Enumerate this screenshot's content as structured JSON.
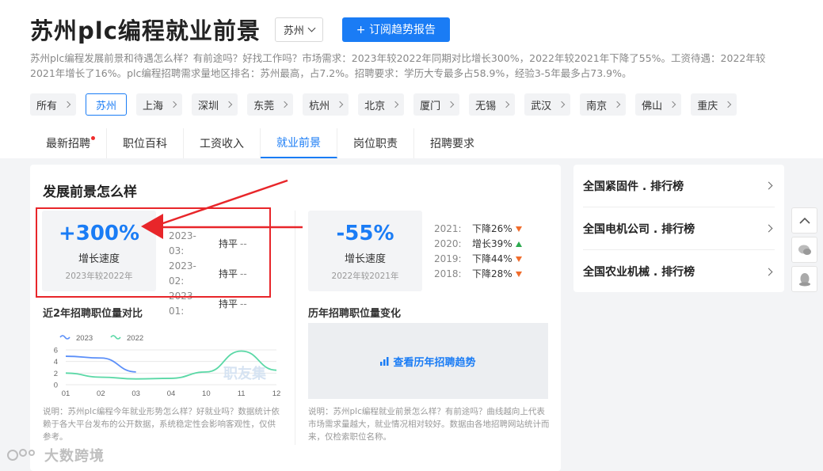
{
  "header": {
    "title": "苏州plc编程就业前景",
    "city_select": "苏州",
    "subscribe_button": "+ 订阅趋势报告",
    "description": "苏州plc编程发展前景和待遇怎么样？有前途吗？好找工作吗？市场需求：2023年较2022年同期对比增长300%，2022年较2021年下降了55%。工资待遇：2022年较2021年增长了16%。plc编程招聘需求量地区排名：苏州最高，占7.2%。招聘要求：学历大专最多占58.9%，经验3-5年最多占73.9%。"
  },
  "cities": [
    {
      "label": "所有",
      "active": false
    },
    {
      "label": "苏州",
      "active": true
    },
    {
      "label": "上海",
      "active": false
    },
    {
      "label": "深圳",
      "active": false
    },
    {
      "label": "东莞",
      "active": false
    },
    {
      "label": "杭州",
      "active": false
    },
    {
      "label": "北京",
      "active": false
    },
    {
      "label": "厦门",
      "active": false
    },
    {
      "label": "无锡",
      "active": false
    },
    {
      "label": "武汉",
      "active": false
    },
    {
      "label": "南京",
      "active": false
    },
    {
      "label": "佛山",
      "active": false
    },
    {
      "label": "重庆",
      "active": false
    }
  ],
  "tabs": [
    {
      "label": "最新招聘",
      "active": false,
      "dot": true
    },
    {
      "label": "职位百科",
      "active": false,
      "dot": false
    },
    {
      "label": "工资收入",
      "active": false,
      "dot": false
    },
    {
      "label": "就业前景",
      "active": true,
      "dot": false
    },
    {
      "label": "岗位职责",
      "active": false,
      "dot": false
    },
    {
      "label": "招聘要求",
      "active": false,
      "dot": false
    }
  ],
  "main": {
    "section_title": "发展前景怎么样",
    "stat1": {
      "value": "+300%",
      "label": "增长速度",
      "sub": "2023年较2022年"
    },
    "list1": [
      {
        "k": "2023-03:",
        "v": "持平",
        "t": "--"
      },
      {
        "k": "2023-02:",
        "v": "持平",
        "t": "--"
      },
      {
        "k": "2023-01:",
        "v": "持平",
        "t": "--"
      }
    ],
    "stat2": {
      "value": "-55%",
      "label": "增长速度",
      "sub": "2022年较2021年"
    },
    "list2": [
      {
        "k": "2021:",
        "v": "下降26%",
        "dir": "down"
      },
      {
        "k": "2020:",
        "v": "增长39%",
        "dir": "up"
      },
      {
        "k": "2019:",
        "v": "下降44%",
        "dir": "down"
      },
      {
        "k": "2018:",
        "v": "下降28%",
        "dir": "down"
      }
    ],
    "chart_title": "近2年招聘职位量对比",
    "trend_title": "历年招聘职位量变化",
    "trend_link": "查看历年招聘趋势",
    "note_left": "说明：苏州plc编程今年就业形势怎么样？好就业吗？数据统计依赖于各大平台发布的公开数据，系统稳定性会影响客观性，仅供参考。",
    "note_right": "说明：苏州plc编程就业前景怎么样？有前途吗？曲线越向上代表市场需求量越大，就业情况相对较好。数据由各地招聘网站统计而来，仅检索职位名称。",
    "chart_watermark": "职友集"
  },
  "side": {
    "ranks": [
      {
        "label": "全国紧固件 . 排行榜"
      },
      {
        "label": "全国电机公司 . 排行榜"
      },
      {
        "label": "全国农业机械 . 排行榜"
      }
    ]
  },
  "watermark": "大数跨境",
  "chart_data": {
    "type": "line",
    "title": "近2年招聘职位量对比",
    "categories": [
      "01",
      "02",
      "03",
      "04",
      "10",
      "11",
      "12"
    ],
    "series": [
      {
        "name": "2023",
        "values": [
          4.9,
          4.6,
          2.2,
          null,
          null,
          null,
          null
        ],
        "color": "#5b8ff9"
      },
      {
        "name": "2022",
        "values": [
          2.0,
          1.3,
          1.0,
          1.1,
          2.2,
          5.8,
          2.5
        ],
        "color": "#5ad8a6"
      }
    ],
    "ylim": [
      0,
      6
    ],
    "yticks": [
      0,
      2,
      4,
      6
    ],
    "legend": "top-left",
    "grid": true
  }
}
